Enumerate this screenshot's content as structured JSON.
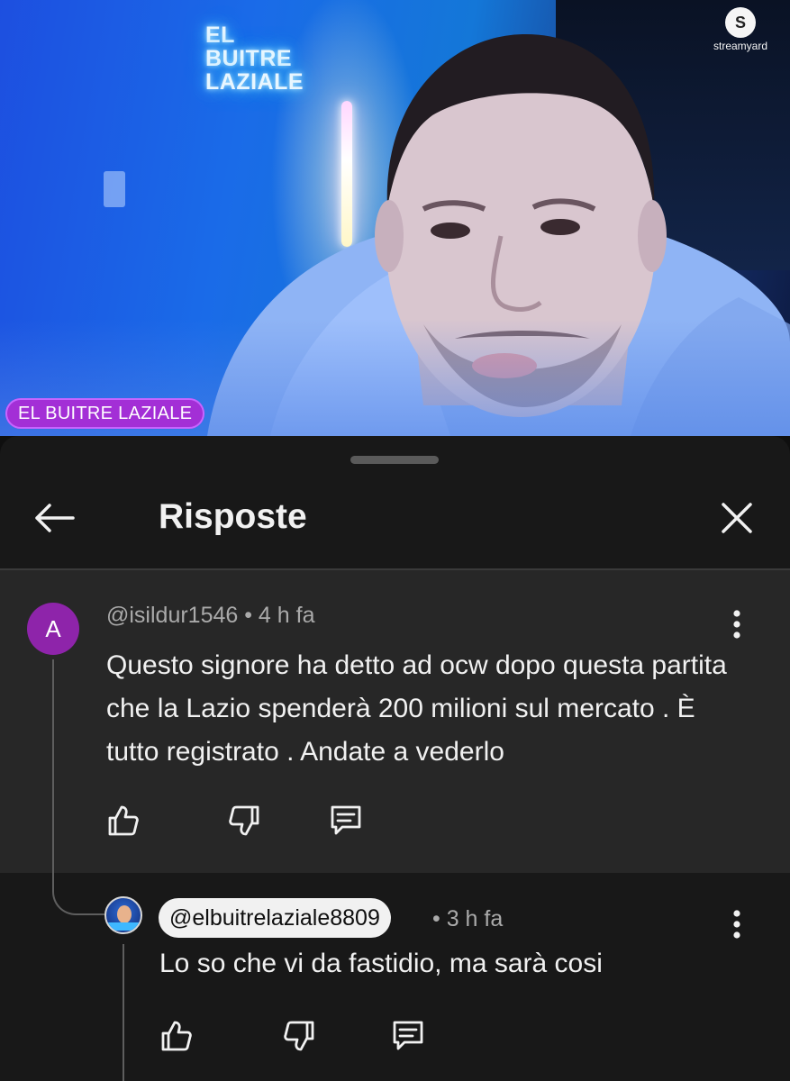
{
  "video": {
    "neon_sign": "EL BUITRE\nLAZIALE",
    "streamyard_logo": "S",
    "streamyard_label": "streamyard",
    "name_tag": "EL BUITRE LAZIALE",
    "colors": {
      "name_tag": "#a32fd6",
      "background": "#1a6be8"
    }
  },
  "panel": {
    "title": "Risposte",
    "icons": {
      "back": "arrow-left-icon",
      "close": "close-icon"
    }
  },
  "parent_comment": {
    "avatar_letter": "A",
    "avatar_color": "#8e24aa",
    "meta": "@isildur1546 • 4 h fa",
    "text": "Questo signore ha detto ad ocw dopo questa partita che la Lazio spenderà 200 milioni sul mercato . È tutto registrato . Andate a vederlo",
    "actions": [
      "like-icon",
      "dislike-icon",
      "reply-icon"
    ]
  },
  "reply_comment": {
    "author": "@elbuitrelaziale8809",
    "time": "• 3 h fa",
    "text": "Lo so che vi da fastidio, ma sarà cosi",
    "actions": [
      "like-icon",
      "dislike-icon",
      "reply-icon"
    ]
  }
}
